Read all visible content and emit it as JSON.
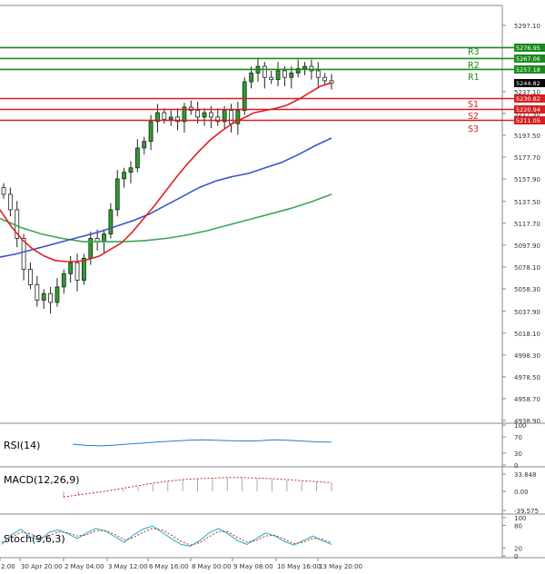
{
  "chart_data": {
    "type": "candlestick",
    "instrument_timeframe": "H4",
    "price_axis": {
      "ticks": [
        "5297.10",
        "5276.95",
        "5257.18",
        "5237.10",
        "5217.30",
        "5197.50",
        "5177.70",
        "5157.90",
        "5137.50",
        "5117.70",
        "5097.90",
        "5078.10",
        "5058.30",
        "5037.90",
        "5018.10",
        "4998.30",
        "4978.50",
        "4958.70",
        "4938.90"
      ],
      "range": [
        4938.9,
        5307.0
      ]
    },
    "time_axis": {
      "labels": [
        "2:00",
        "30 Apr 20:00",
        "2 May 04:00",
        "3 May 12:00",
        "6 May 16:00",
        "8 May 00:00",
        "9 May 08:00",
        "10 May 16:00",
        "13 May 20:00"
      ]
    },
    "current_price": "5244.82",
    "levels": [
      {
        "name": "R3",
        "value": 5276.95,
        "label": "5276.95",
        "color": "#1a8a1a"
      },
      {
        "name": "R2",
        "value": 5267.06,
        "label": "5267.06",
        "color": "#1a8a1a"
      },
      {
        "name": "R1",
        "value": 5257.18,
        "label": "5257.18",
        "color": "#1a8a1a"
      },
      {
        "name": "S1",
        "value": 5230.82,
        "label": "5230.82",
        "color": "#d42020"
      },
      {
        "name": "S2",
        "value": 5220.94,
        "label": "5220.94",
        "color": "#d42020"
      },
      {
        "name": "S3",
        "value": 5211.05,
        "label": "5211.05",
        "color": "#d42020"
      }
    ],
    "level_names": [
      "R3",
      "R2",
      "R1",
      "S1",
      "S2",
      "S3"
    ],
    "closes": [
      5144,
      5130,
      5104,
      5076,
      5062,
      5048,
      5054,
      5046,
      5060,
      5072,
      5082,
      5066,
      5086,
      5104,
      5101,
      5108,
      5130,
      5158,
      5164,
      5168,
      5186,
      5192,
      5210,
      5218,
      5212,
      5214,
      5210,
      5223,
      5220,
      5214,
      5218,
      5214,
      5210,
      5220,
      5208,
      5220,
      5246,
      5254,
      5260,
      5250,
      5248,
      5256,
      5250,
      5254,
      5258,
      5260,
      5256,
      5250,
      5247,
      5245
    ],
    "ma_red": [
      5130,
      5115,
      5103,
      5094,
      5088,
      5084,
      5083,
      5083,
      5085,
      5088,
      5094,
      5100,
      5110,
      5122,
      5134,
      5147,
      5160,
      5172,
      5183,
      5193,
      5201,
      5208,
      5213,
      5218,
      5220,
      5222,
      5225,
      5230,
      5236,
      5242,
      5245
    ],
    "ma_blue": [
      5087,
      5090,
      5094,
      5098,
      5102,
      5106,
      5110,
      5115,
      5120,
      5126,
      5134,
      5142,
      5150,
      5156,
      5160,
      5163,
      5168,
      5173,
      5180,
      5188,
      5195
    ],
    "ma_green": [
      5122,
      5114,
      5108,
      5104,
      5101,
      5101,
      5101,
      5102,
      5104,
      5107,
      5111,
      5116,
      5121,
      5126,
      5131,
      5137,
      5144
    ],
    "indicators": {
      "rsi": {
        "label": "RSI(14)",
        "ticks": [
          "100",
          "70",
          "30",
          "0"
        ],
        "values": [
          52,
          49,
          48,
          50,
          53,
          55,
          58,
          60,
          62,
          63,
          62,
          61,
          60,
          61,
          63,
          62,
          60,
          58,
          57
        ]
      },
      "macd": {
        "label": "MACD(12,26,9)",
        "ticks": [
          "33.848",
          "0.00",
          "-39.575"
        ],
        "values": [
          -12,
          -8,
          -4,
          0,
          5,
          10,
          15,
          19,
          22,
          24,
          25,
          26,
          26,
          25,
          24,
          22,
          20,
          18,
          16
        ]
      },
      "stoch": {
        "label": "Stoch(9,6,3)",
        "ticks": [
          "100",
          "80",
          "20",
          "0"
        ],
        "k": [
          30,
          55,
          70,
          50,
          40,
          62,
          68,
          58,
          45,
          60,
          72,
          65,
          50,
          35,
          55,
          70,
          78,
          62,
          45,
          30,
          25,
          40,
          60,
          72,
          58,
          40,
          30,
          45,
          60,
          52,
          38,
          28,
          40,
          52,
          40,
          30
        ],
        "d": [
          35,
          48,
          62,
          58,
          46,
          52,
          63,
          61,
          52,
          55,
          66,
          66,
          56,
          42,
          48,
          62,
          72,
          68,
          54,
          38,
          28,
          34,
          50,
          64,
          63,
          48,
          36,
          40,
          52,
          54,
          44,
          32,
          36,
          46,
          44,
          34
        ]
      }
    }
  }
}
